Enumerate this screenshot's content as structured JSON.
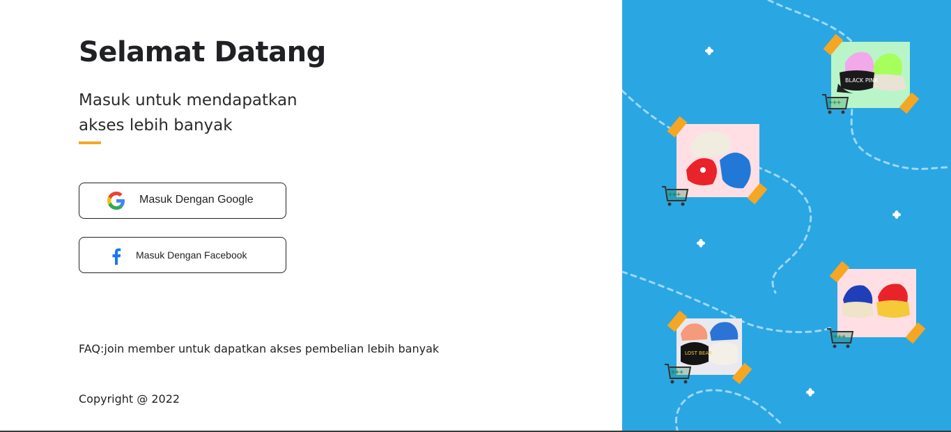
{
  "welcome": {
    "title": "Selamat Datang",
    "subtitle": "Masuk untuk mendapatkan akses lebih banyak"
  },
  "auth": {
    "google_label": "Masuk Dengan Google",
    "facebook_label": "Masuk Dengan Facebook"
  },
  "footer": {
    "faq": "FAQ:join member untuk dapatkan akses pembelian lebih banyak",
    "copyright": "Copyright @ 2022"
  },
  "illustration": {
    "background_color": "#2aa7e2",
    "accent_color": "#f5a623",
    "products": [
      {
        "name": "product-card-cap-pink-green",
        "bg": "#b9f5c9",
        "cap_text": "BLACK PINK"
      },
      {
        "name": "product-card-bucket-hats",
        "bg": "#ffdfe4"
      },
      {
        "name": "product-card-cap-blue-red",
        "bg": "#ffdfe4"
      },
      {
        "name": "product-card-cap-lost-bear",
        "bg": "#e9e9ef",
        "cap_text": "LOST BEAR"
      }
    ]
  }
}
